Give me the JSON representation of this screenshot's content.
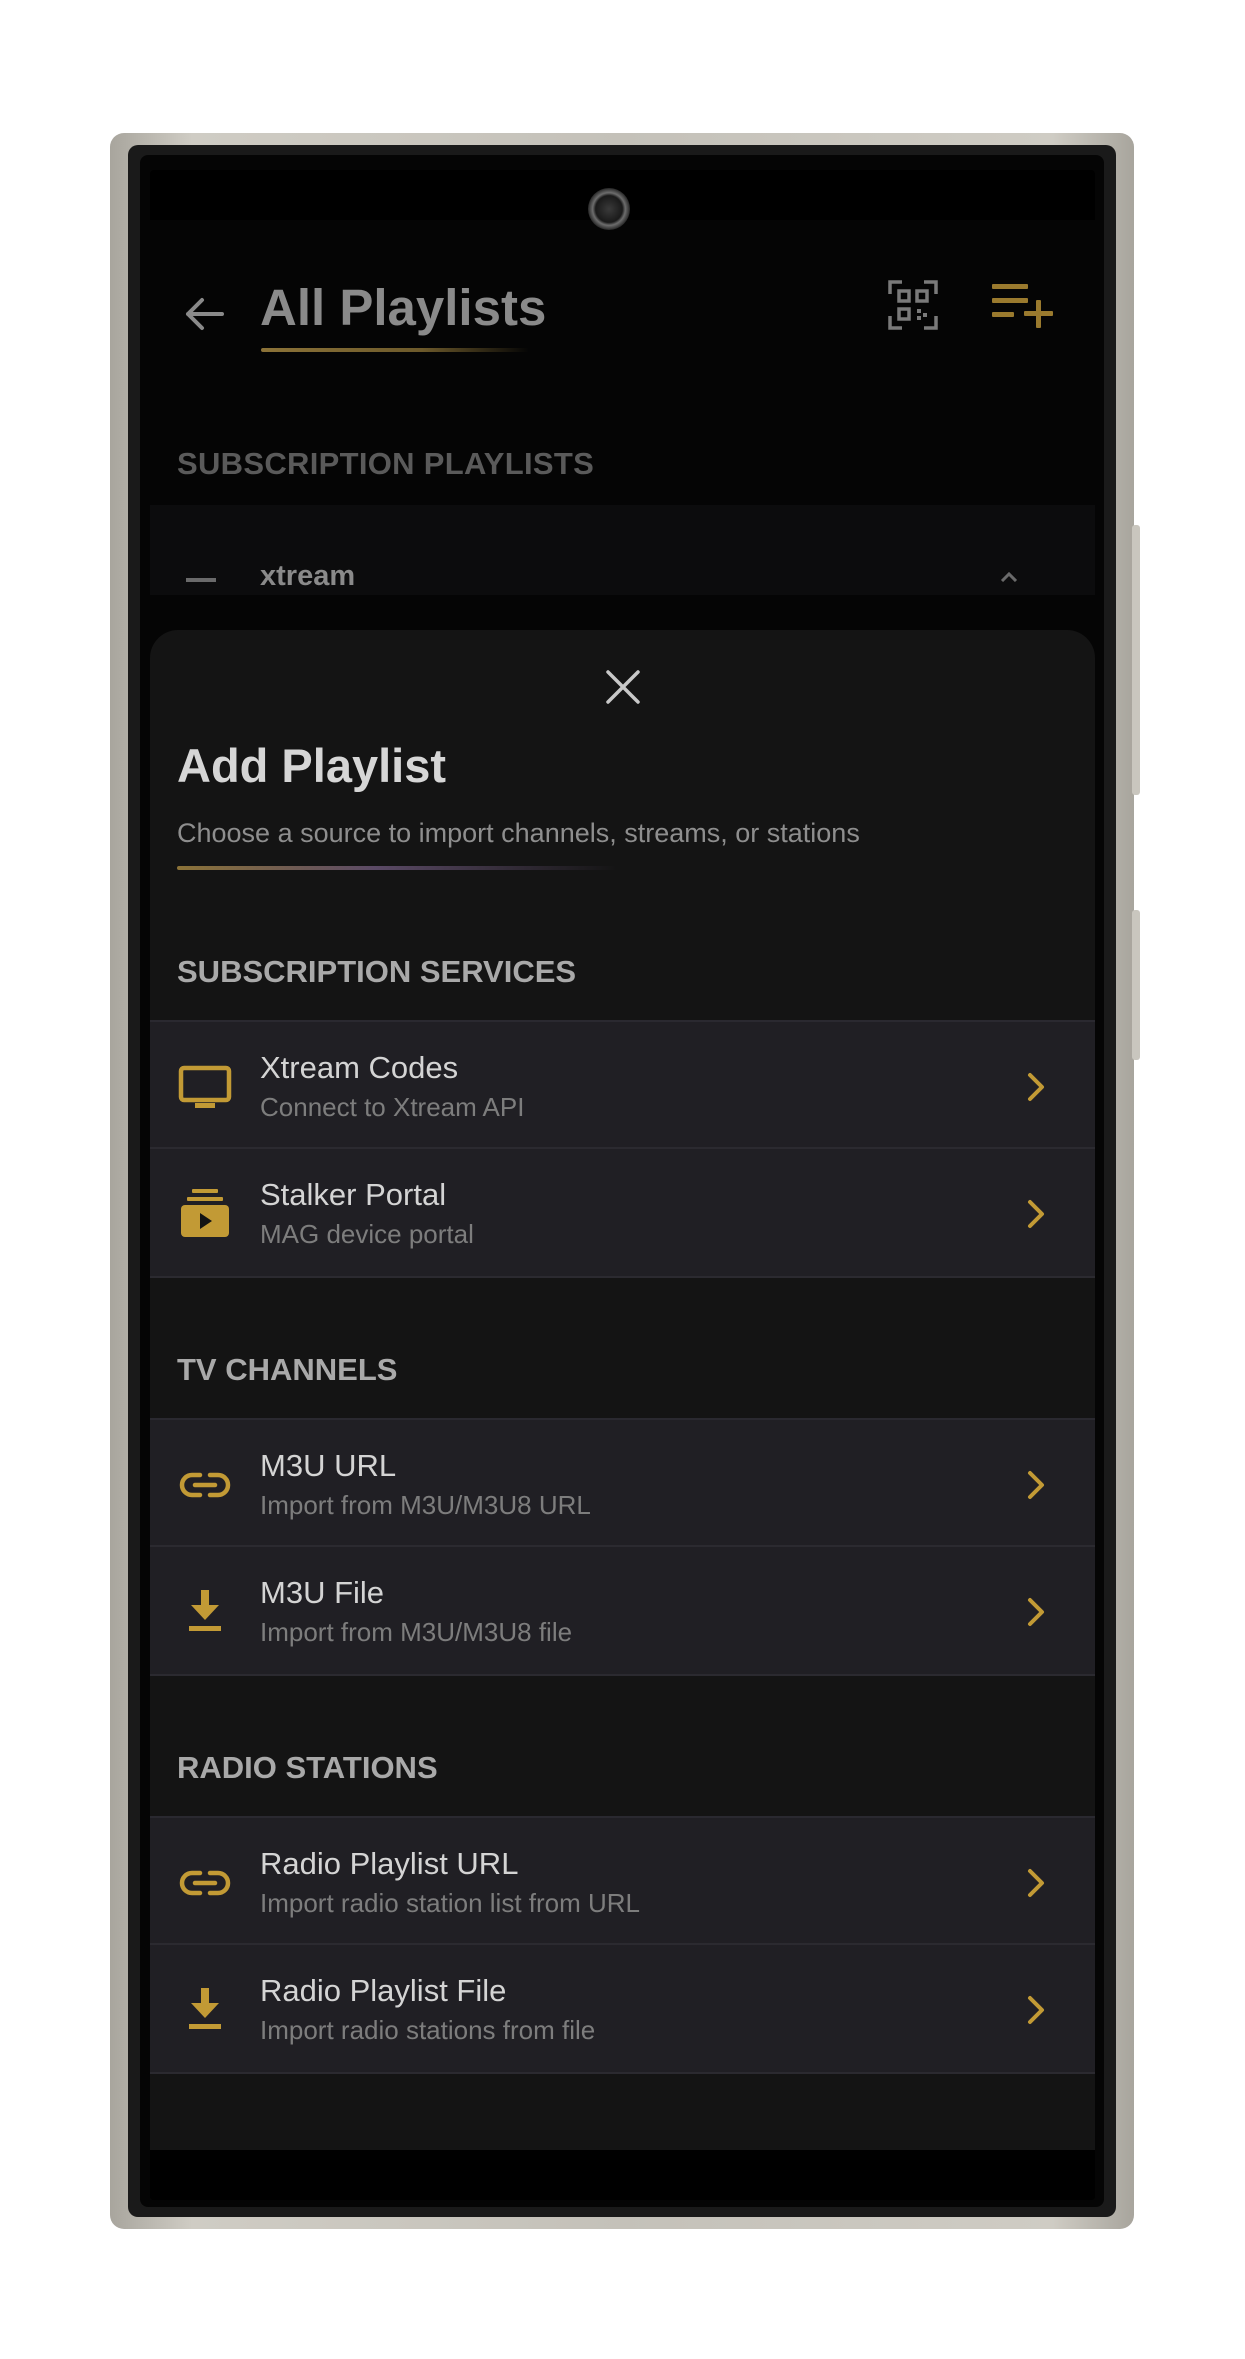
{
  "colors": {
    "accent": "#c29a35",
    "sheet_bg": "#141414",
    "row_bg": "#201f24",
    "text_primary": "#d4d4d4",
    "text_secondary": "#7d7d7d"
  },
  "background_screen": {
    "title": "All Playlists",
    "section_label": "SUBSCRIPTION PLAYLISTS",
    "peek_item": "xtream",
    "icons": [
      "back-arrow-icon",
      "qr-code-icon",
      "playlist-add-icon"
    ]
  },
  "sheet": {
    "title": "Add Playlist",
    "subtitle": "Choose a source to import channels, streams, or stations",
    "close_icon": "close-icon",
    "sections": [
      {
        "title": "SUBSCRIPTION SERVICES",
        "items": [
          {
            "title": "Xtream Codes",
            "subtitle": "Connect to Xtream API",
            "icon": "tv-icon"
          },
          {
            "title": "Stalker Portal",
            "subtitle": "MAG device portal",
            "icon": "portal-icon"
          }
        ]
      },
      {
        "title": "TV CHANNELS",
        "items": [
          {
            "title": "M3U URL",
            "subtitle": "Import from M3U/M3U8 URL",
            "icon": "link-icon"
          },
          {
            "title": "M3U File",
            "subtitle": "Import from M3U/M3U8 file",
            "icon": "download-icon"
          }
        ]
      },
      {
        "title": "RADIO STATIONS",
        "items": [
          {
            "title": "Radio Playlist URL",
            "subtitle": "Import radio station list from URL",
            "icon": "link-icon"
          },
          {
            "title": "Radio Playlist File",
            "subtitle": "Import radio stations from file",
            "icon": "download-icon"
          }
        ]
      }
    ]
  }
}
